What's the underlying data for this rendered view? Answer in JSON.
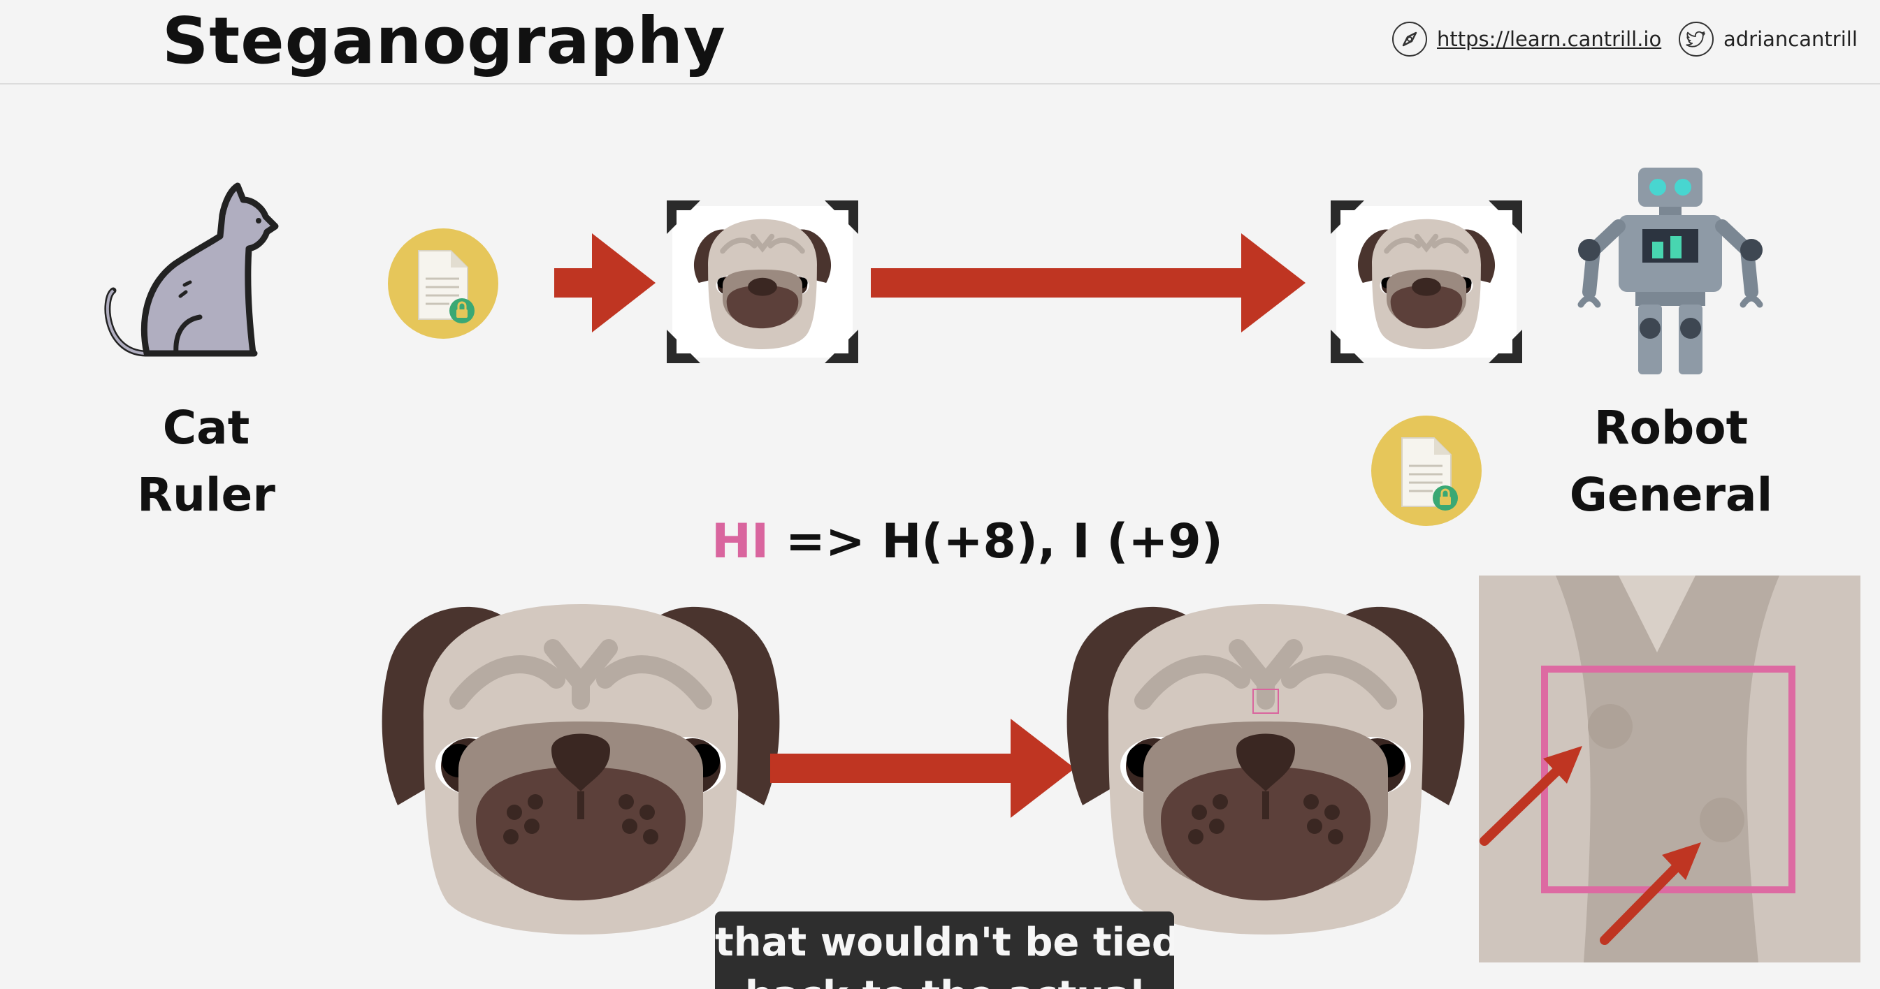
{
  "header": {
    "title": "Steganography",
    "website": "https://learn.cantrill.io",
    "twitter": "adriancantrill"
  },
  "labels": {
    "cat_line1": "Cat",
    "cat_line2": "Ruler",
    "robot_line1": "Robot",
    "robot_line2": "General"
  },
  "equation": {
    "highlight": "HI",
    "rest": " => H(+8), I (+9)"
  },
  "caption": {
    "line1": "that wouldn't be tied",
    "line2": "back to the actual"
  },
  "colors": {
    "arrow": "#bf3522",
    "highlight_pink": "#d9659e",
    "doc_circle": "#e6c65a",
    "caption_bg": "#2e2e2e"
  },
  "icons": [
    "cat-icon",
    "robot-icon",
    "document-lock-icon",
    "pug-icon",
    "compass-icon",
    "twitter-icon"
  ]
}
